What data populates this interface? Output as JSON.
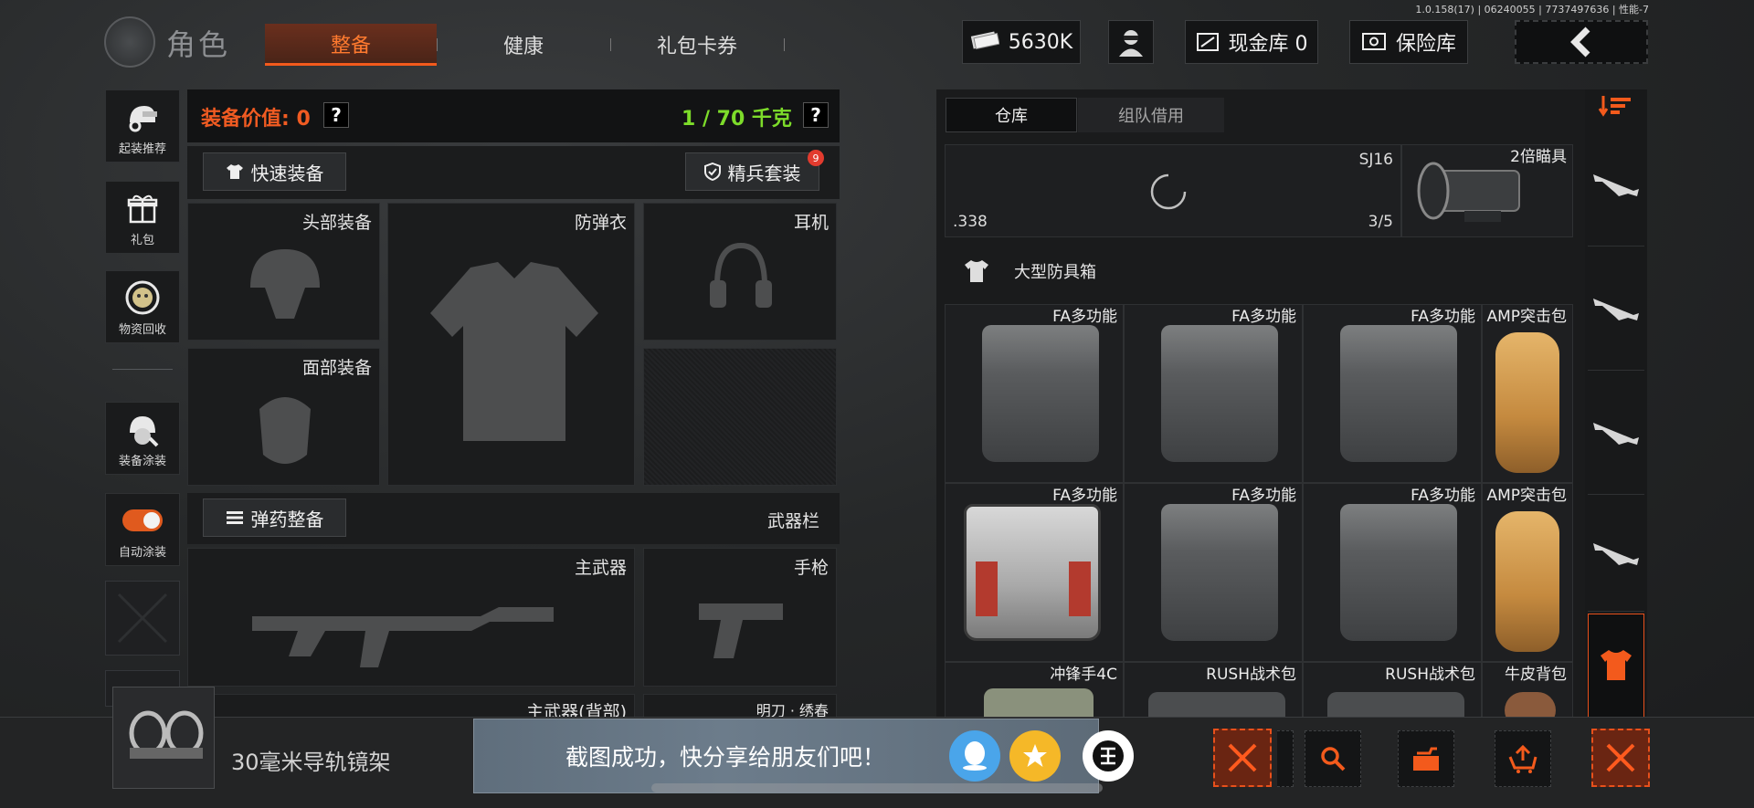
{
  "version": "1.0.158(17) | 06240055 | 7737497636 | 性能-7",
  "header": {
    "title": "角色",
    "tabs": [
      {
        "label": "整备",
        "active": true
      },
      {
        "label": "健康",
        "active": false
      },
      {
        "label": "礼包卡券",
        "active": false
      }
    ],
    "currency": "5630K",
    "cash_vault": "现金库 0",
    "safe_box": "保险库"
  },
  "sidebar": {
    "items": [
      {
        "label": "起装推荐",
        "icon": "helmet-gear-icon"
      },
      {
        "label": "礼包",
        "icon": "gift-icon"
      },
      {
        "label": "物资回收",
        "icon": "recycle-icon"
      },
      {
        "label": "装备涂装",
        "icon": "paint-helmet-icon"
      },
      {
        "label": "自动涂装",
        "icon": "toggle-icon",
        "toggle_on": true
      }
    ]
  },
  "equipment": {
    "value_label": "装备价值: 0",
    "weight_label": "1 / 70 千克",
    "help": "?",
    "quick_equip": "快速装备",
    "elite_set": "精兵套装",
    "elite_badge": "9",
    "slots": {
      "head": "头部装备",
      "armor": "防弹衣",
      "headset": "耳机",
      "face": "面部装备",
      "primary": "主武器",
      "pistol": "手枪",
      "primary_back": "主武器(背部)",
      "melee": "明刀 · 绣春"
    },
    "ammo_equip": "弹药整备",
    "weapon_bar": "武器栏"
  },
  "warehouse": {
    "tabs": [
      {
        "label": "仓库",
        "active": true
      },
      {
        "label": "组队借用",
        "active": false
      }
    ],
    "top_row": {
      "ammo_label": ".338",
      "ammo_name": "SJ16",
      "ammo_count": "3/5",
      "scope_name": "2倍瞄具"
    },
    "section_label": "大型防具箱",
    "grid": [
      {
        "title": "FA多功能",
        "kind": "grey-bag"
      },
      {
        "title": "FA多功能",
        "kind": "grey-bag"
      },
      {
        "title": "FA多功能",
        "kind": "grey-bag"
      },
      {
        "title": "AMP突击包",
        "kind": "tan-bag"
      },
      {
        "title": "FA多功能",
        "kind": "white-bag"
      },
      {
        "title": "FA多功能",
        "kind": "grey-bag"
      },
      {
        "title": "FA多功能",
        "kind": "grey-bag"
      },
      {
        "title": "AMP突击包",
        "kind": "tan-bag"
      },
      {
        "title": "冲锋手4C",
        "kind": "olive-bag"
      },
      {
        "title": "RUSH战术包",
        "kind": "grey-bag"
      },
      {
        "title": "RUSH战术包",
        "kind": "grey-bag"
      },
      {
        "title": "牛皮背包",
        "kind": "brown-bag"
      }
    ]
  },
  "filters": [
    "sort-icon",
    "rifle-icon",
    "rifle-icon",
    "rifle-icon",
    "rifle-icon",
    "armor-filter-icon"
  ],
  "bottom": {
    "item_name": "30毫米导轨镜架",
    "toast": "截图成功，快分享给朋友们吧！"
  },
  "colors": {
    "accent": "#f35a1c",
    "weight_green": "#7ddc2a",
    "value_orange": "#f05b22"
  }
}
